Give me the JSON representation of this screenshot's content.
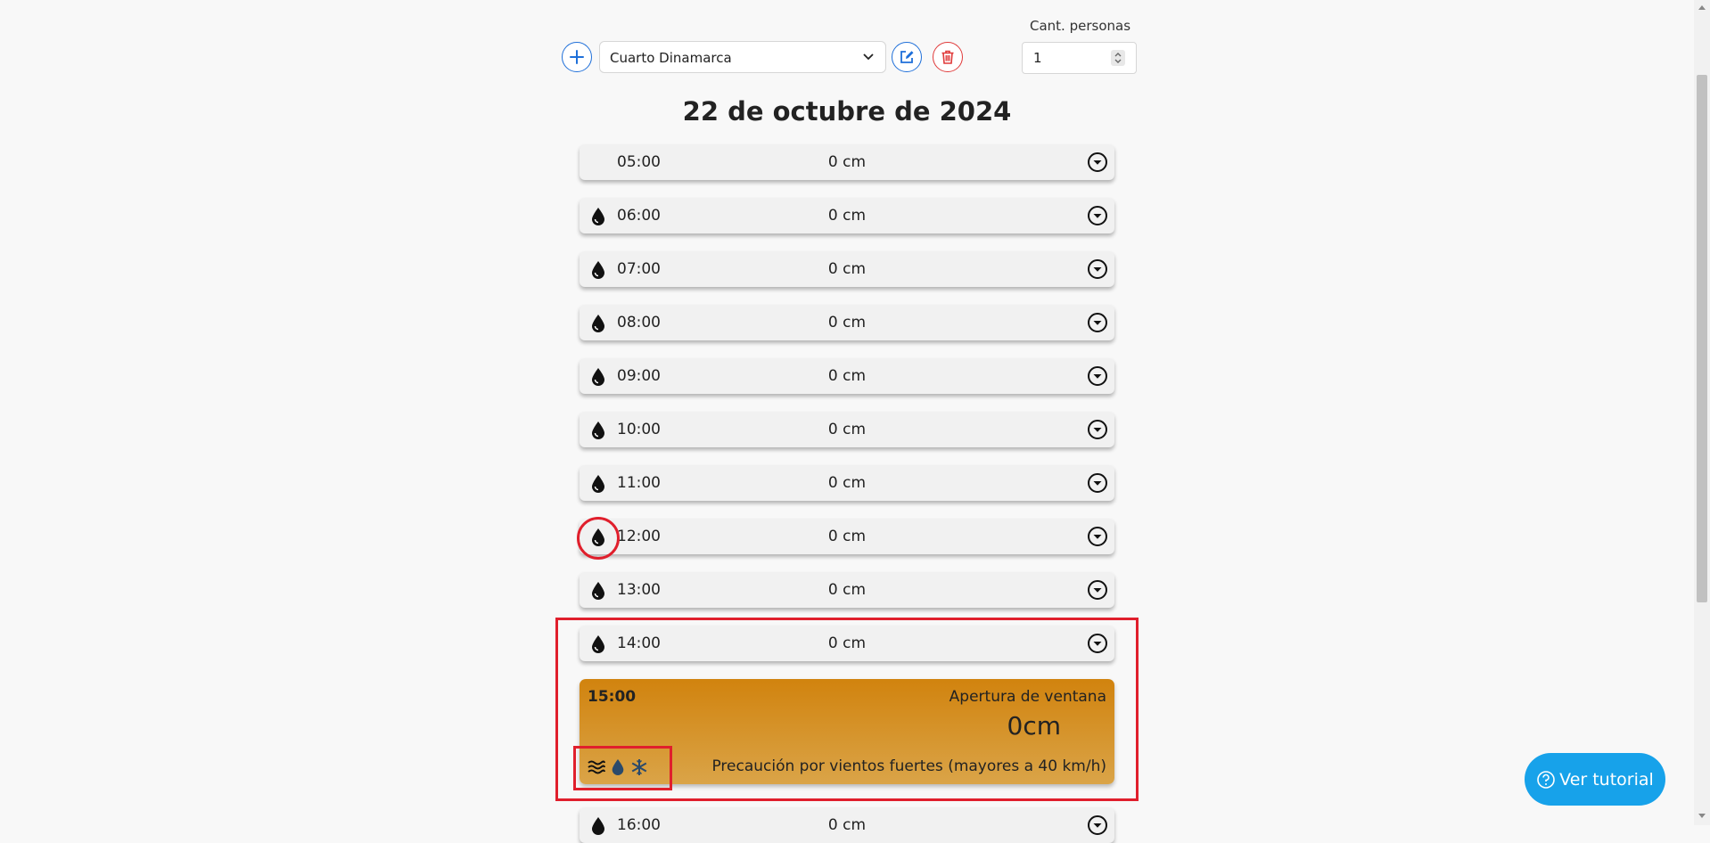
{
  "header": {
    "room_select_value": "Cuarto Dinamarca",
    "persons_label": "Cant. personas",
    "persons_value": "1"
  },
  "date_title": "22 de octubre de 2024",
  "hours": [
    {
      "time": "05:00",
      "value": "0 cm",
      "has_drop_icon": false
    },
    {
      "time": "06:00",
      "value": "0 cm",
      "has_drop_icon": true
    },
    {
      "time": "07:00",
      "value": "0 cm",
      "has_drop_icon": true
    },
    {
      "time": "08:00",
      "value": "0 cm",
      "has_drop_icon": true
    },
    {
      "time": "09:00",
      "value": "0 cm",
      "has_drop_icon": true
    },
    {
      "time": "10:00",
      "value": "0 cm",
      "has_drop_icon": true
    },
    {
      "time": "11:00",
      "value": "0 cm",
      "has_drop_icon": true
    },
    {
      "time": "12:00",
      "value": "0 cm",
      "has_drop_icon": true
    },
    {
      "time": "13:00",
      "value": "0 cm",
      "has_drop_icon": true
    },
    {
      "time": "14:00",
      "value": "0 cm",
      "has_drop_icon": true
    },
    {
      "time": "16:00",
      "value": "0 cm",
      "has_drop_icon": true
    }
  ],
  "highlight": {
    "hour": "15:00",
    "label": "Apertura de ventana",
    "value": "0cm",
    "warning": "Precaución por vientos fuertes (mayores a 40 km/h)",
    "icons": [
      "wind-waves-icon",
      "water-drop-icon",
      "snowflake-icon"
    ]
  },
  "tutorial_button_label": "Ver tutorial",
  "colors": {
    "accent_blue": "#1e6fd9",
    "delete_red": "#e03a3a",
    "highlight_orange": "#d1830e",
    "tutorial_blue": "#17a2ea",
    "annotation_red": "#e01f2c"
  }
}
